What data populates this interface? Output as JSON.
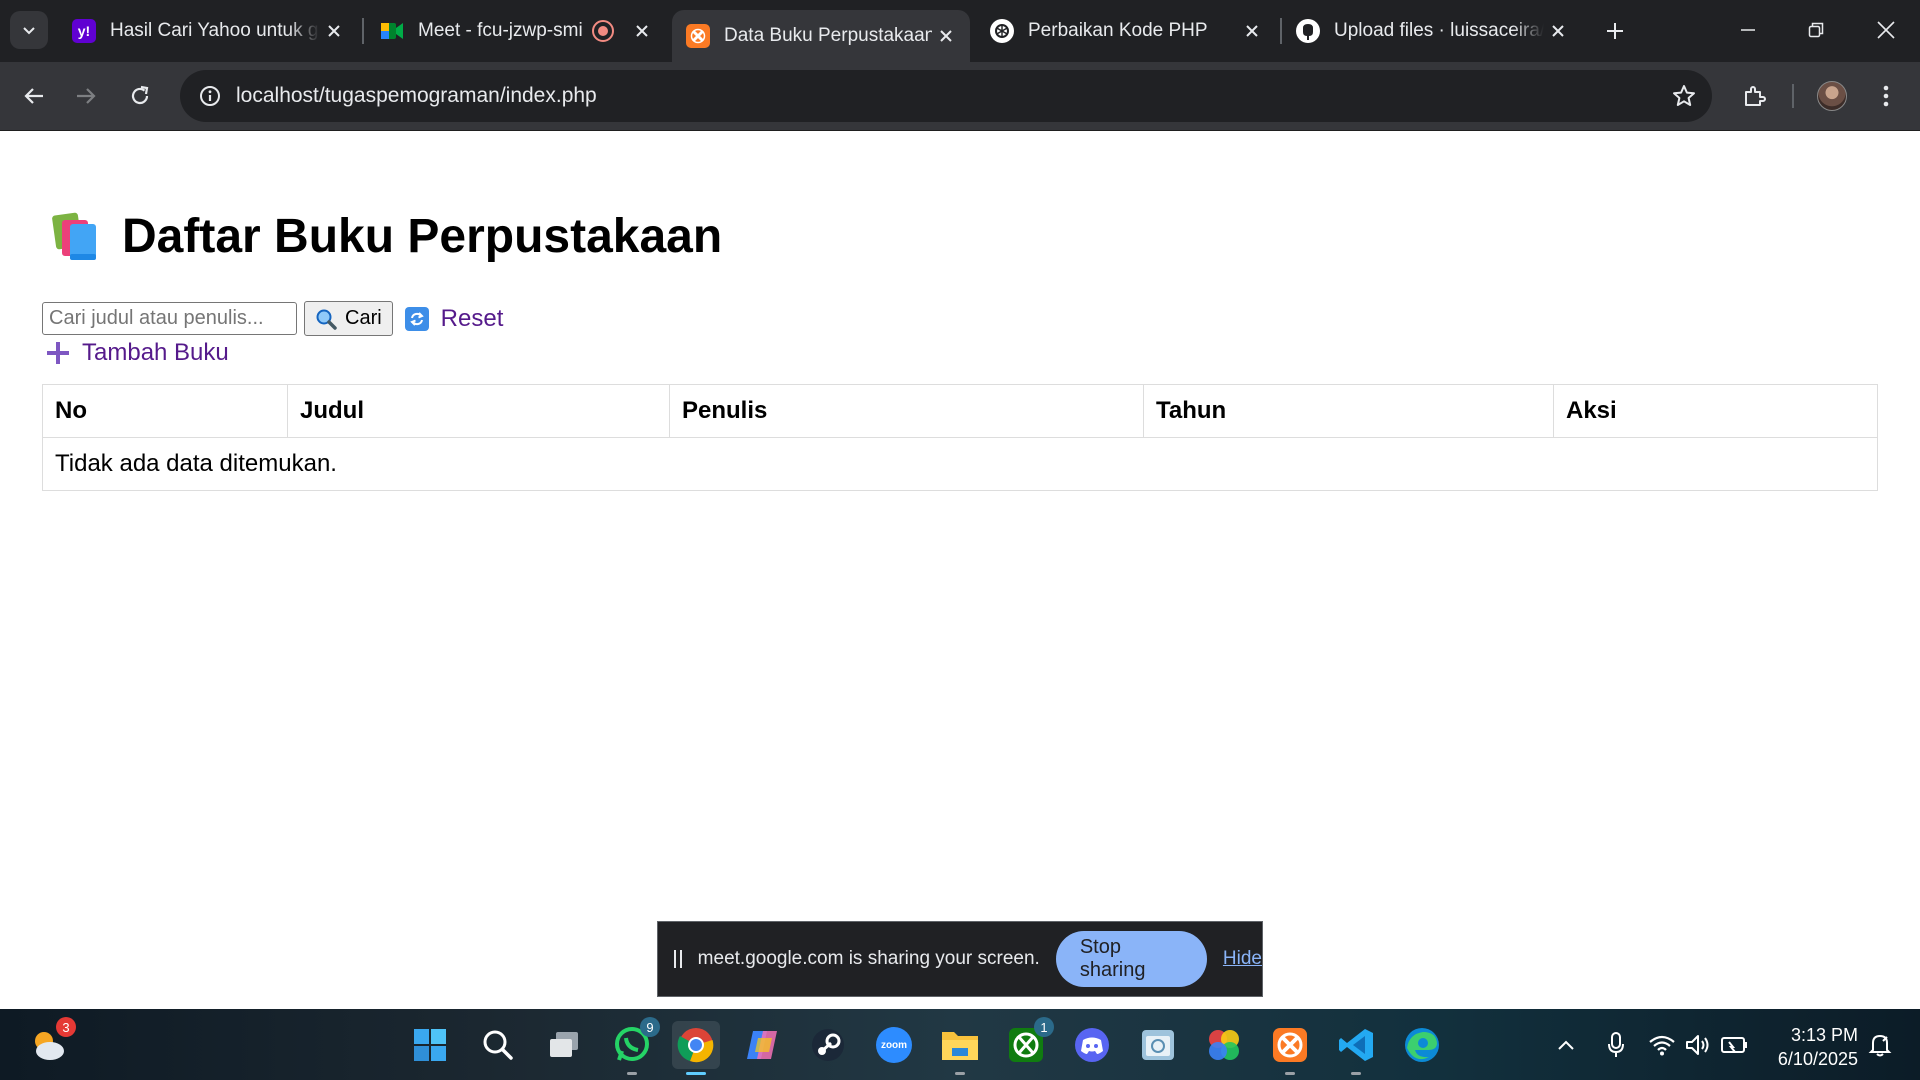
{
  "browser": {
    "tabs": [
      {
        "title": "Hasil Cari Yahoo untuk graphic",
        "favicon": "yahoo-icon",
        "fav_text": "y!",
        "active": false
      },
      {
        "title": "Meet - fcu-jzwp-smi",
        "favicon": "google-meet-icon",
        "active": false,
        "recording": true
      },
      {
        "title": "Data Buku Perpustakaan",
        "favicon": "xampp-icon",
        "active": true
      },
      {
        "title": "Perbaikan Kode PHP",
        "favicon": "chatgpt-icon",
        "active": false
      },
      {
        "title": "Upload files · luissaceira/tugas",
        "favicon": "github-icon",
        "active": false
      }
    ],
    "url": "localhost/tugaspemograman/index.php"
  },
  "page": {
    "title": "Daftar Buku Perpustakaan",
    "search": {
      "placeholder": "Cari judul atau penulis...",
      "button_label": "Cari"
    },
    "reset_label": "Reset",
    "add_label": "Tambah Buku",
    "table": {
      "columns": [
        "No",
        "Judul",
        "Penulis",
        "Tahun",
        "Aksi"
      ],
      "empty_message": "Tidak ada data ditemukan."
    }
  },
  "share_bar": {
    "text": "meet.google.com is sharing your screen.",
    "stop_label": "Stop sharing",
    "hide_label": "Hide"
  },
  "taskbar": {
    "weather_badge": "3",
    "whatsapp_badge": "9",
    "xbox_badge": "1",
    "zoom_label": "zoom",
    "time": "3:13 PM",
    "date": "6/10/2025"
  },
  "colors": {
    "link": "#551a8b",
    "share_button": "#8ab4f8",
    "chrome_dark": "#202124",
    "chrome_toolbar": "#35363a"
  }
}
